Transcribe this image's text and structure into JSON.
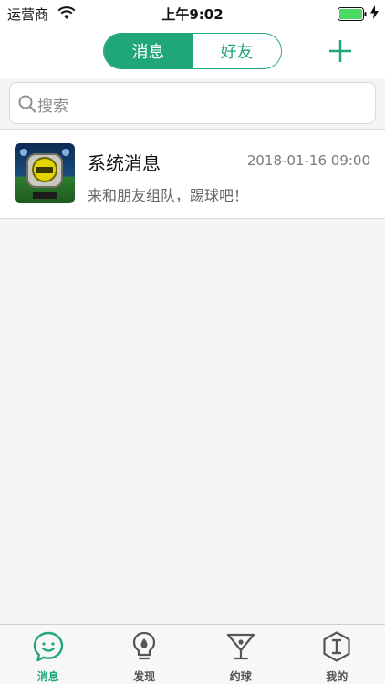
{
  "status_bar": {
    "carrier": "运营商",
    "time": "上午9:02"
  },
  "header": {
    "tabs": [
      {
        "label": "消息",
        "active": true
      },
      {
        "label": "好友",
        "active": false
      }
    ],
    "add_icon": "plus-icon"
  },
  "search": {
    "placeholder": "搜索"
  },
  "messages": [
    {
      "title": "系统消息",
      "time": "2018-01-16 09:00",
      "preview": "来和朋友组队，踢球吧！",
      "avatar_icon": "soccer-app-logo"
    }
  ],
  "tab_bar": {
    "items": [
      {
        "label": "消息",
        "icon": "chat-smile-icon",
        "active": true
      },
      {
        "label": "发现",
        "icon": "lightbulb-icon",
        "active": false
      },
      {
        "label": "约球",
        "icon": "cocktail-glass-icon",
        "active": false
      },
      {
        "label": "我的",
        "icon": "hexagon-profile-icon",
        "active": false
      }
    ]
  },
  "colors": {
    "accent": "#1fa67a",
    "background": "#f5f5f7"
  }
}
